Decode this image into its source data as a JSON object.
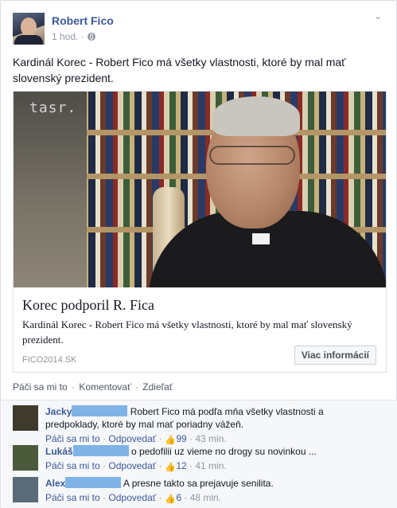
{
  "post": {
    "author": "Robert Fico",
    "time": "1 hod. ·",
    "text": "Kardinál Korec - Robert Fico má všetky vlastnosti, ktoré by mal mať slovenský prezident.",
    "link": {
      "watermark": "tasr.",
      "title": "Korec podporil R. Fica",
      "description": "Kardinál Korec - Robert Fico má všetky vlastnosti, ktoré by mal mať slovenský prezident.",
      "domain": "FICO2014.SK",
      "button": "Viac informácií"
    },
    "actions": {
      "like": "Páči sa mi to",
      "comment": "Komentovať",
      "share": "Zdieľať",
      "sep": "·"
    }
  },
  "comments": [
    {
      "name": "Jacky",
      "text": "Robert Fico má podľa mňa všetky vlastnosti a predpoklady, ktoré by mal mať poriadny vážeň.",
      "like": "Páči sa mi to",
      "reply": "Odpovedať",
      "likes": "99",
      "time": "43 min.",
      "avatar_color": "#3e3a2c"
    },
    {
      "name": "Lukáš",
      "text": "o pedofilii uz vieme no drogy su novinkou ...",
      "like": "Páči sa mi to",
      "reply": "Odpovedať",
      "likes": "12",
      "time": "41 min.",
      "avatar_color": "#4a5a3a"
    },
    {
      "name": "Alex",
      "text": "A presne takto sa prejavuje senilita.",
      "like": "Páči sa mi to",
      "reply": "Odpovedať",
      "likes": "6",
      "time": "48 min.",
      "avatar_color": "#5a6a78"
    }
  ],
  "meta_sep": "·"
}
